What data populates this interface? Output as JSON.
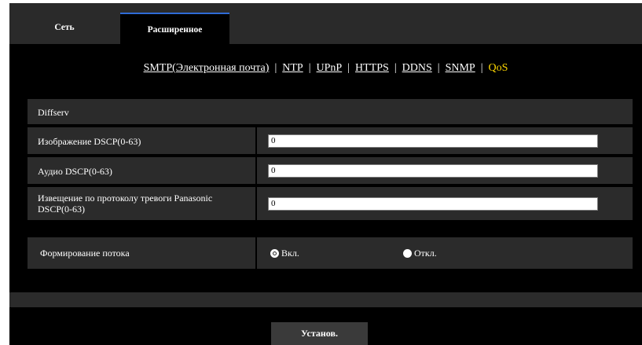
{
  "tabs": [
    {
      "label": "Сеть"
    },
    {
      "label": "Расширенное"
    }
  ],
  "subnav": {
    "items": [
      "SMTP(Электронная почта)",
      "NTP",
      "UPnP",
      "HTTPS",
      "DDNS",
      "SNMP",
      "QoS"
    ],
    "separator": "|"
  },
  "diffserv": {
    "header": "Diffserv",
    "image_label": "Изображение DSCP(0-63)",
    "image_value": "0",
    "audio_label": "Аудио DSCP(0-63)",
    "audio_value": "0",
    "alarm_label_line1": "Извещение по протоколу тревоги Panasonic",
    "alarm_label_line2": "DSCP(0-63)",
    "alarm_value": "0"
  },
  "shaping": {
    "label": "Формирование потока",
    "on_label": "Вкл.",
    "off_label": "Откл.",
    "selected": "on"
  },
  "set_button": "Установ.",
  "colors": {
    "active_link": "#ffd800",
    "tab_accent": "#2f6bd6",
    "panel": "#2b2b2b"
  }
}
